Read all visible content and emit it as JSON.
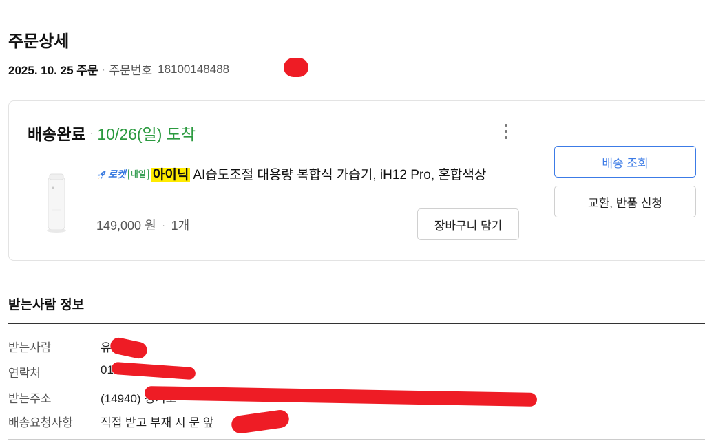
{
  "page": {
    "title": "주문상세",
    "order_date": "2025. 10. 25 주문",
    "order_no_label": "주문번호",
    "order_no": "18100148488"
  },
  "shipment": {
    "status": "배송완료",
    "arrival": "10/26(일) 도착",
    "product": {
      "rocket_label": "로켓",
      "delivery_day": "내일",
      "brand": "아이닉",
      "name": "AI습도조절 대용량 복합식 가습기, iH12 Pro, 혼합색상",
      "price": "149,000 원",
      "quantity": "1개"
    },
    "cart_button": "장바구니 담기",
    "track_button": "배송 조회",
    "return_button": "교환, 반품 신청"
  },
  "recipient": {
    "section_title": "받는사람 정보",
    "rows": [
      {
        "label": "받는사람",
        "value": "유"
      },
      {
        "label": "연락처",
        "value": "010"
      },
      {
        "label": "받는주소",
        "value": "(14940) 경기도"
      },
      {
        "label": "배송요청사항",
        "value": "직접 받고 부재 시 문 앞"
      }
    ]
  },
  "colors": {
    "accent_blue": "#3c7be6",
    "arrival_green": "#2b9a3f",
    "brand_highlight": "#ffeb00",
    "redaction_red": "#ee1c25"
  },
  "icons": [
    "rocket-icon",
    "more-vertical-icon",
    "product-thumbnail"
  ]
}
